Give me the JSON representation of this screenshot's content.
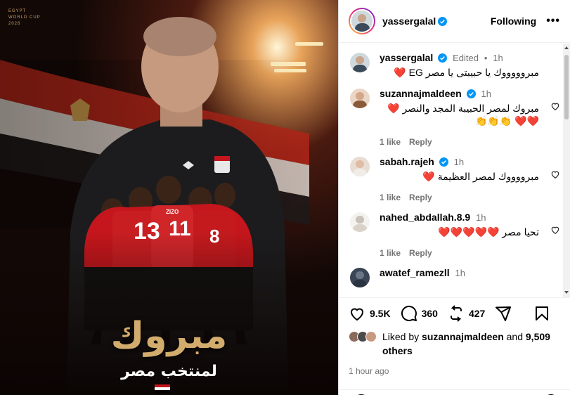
{
  "poster": {
    "wc_label": [
      "EGYPT",
      "WORLD CUP",
      "2026"
    ],
    "headline": "مبروك",
    "subline": "لمنتخب مصر",
    "jersey_numbers": [
      "13",
      "11",
      "8"
    ],
    "jersey_name": "ZIZO",
    "colors": {
      "accent_gold": "#d2ac6c",
      "jersey_red": "#c4161c"
    }
  },
  "header": {
    "username": "yassergalal",
    "follow_label": "Following",
    "more_label": "•••"
  },
  "caption": {
    "username": "yassergalal",
    "edited": "Edited",
    "time": "1h",
    "text": "مبروووووك يا حبيبتى يا مصر EG ❤️"
  },
  "comments": [
    {
      "username": "suzannajmaldeen",
      "verified": true,
      "time": "1h",
      "text": "مبروك لمصر الحبيبة المجد والنصر ❤️❤️❤️",
      "prefix_emoji": "👏👏👏",
      "likes": "1 like",
      "reply": "Reply"
    },
    {
      "username": "sabah.rajeh",
      "verified": true,
      "time": "1h",
      "text": "مبرووووك لمصر العظيمة ❤️",
      "likes": "1 like",
      "reply": "Reply"
    },
    {
      "username": "nahed_abdallah.8.9",
      "verified": false,
      "time": "1h",
      "text": "تحيا مصر ❤️❤️❤️❤️❤️",
      "likes": "1 like",
      "reply": "Reply"
    },
    {
      "username": "awatef_ramezll",
      "verified": false,
      "time": "1h",
      "text": "",
      "likes": "",
      "reply": ""
    }
  ],
  "actions": {
    "likes": "9.5K",
    "comments": "360",
    "reposts": "427"
  },
  "liked_by": {
    "prefix": "Liked by",
    "user": "suzannajmaldeen",
    "and": "and",
    "count": "9,509",
    "others": "others"
  },
  "posted_ago": "1 hour ago",
  "icons": {
    "verified": "verified-badge-icon",
    "like": "heart-icon",
    "comment": "comment-bubble-icon",
    "repost": "repost-icon",
    "share": "share-paper-plane-icon",
    "save": "bookmark-icon"
  },
  "colors": {
    "verified_blue": "#0095f6",
    "heart_red": "#e0245e",
    "muted_text": "#737373"
  }
}
